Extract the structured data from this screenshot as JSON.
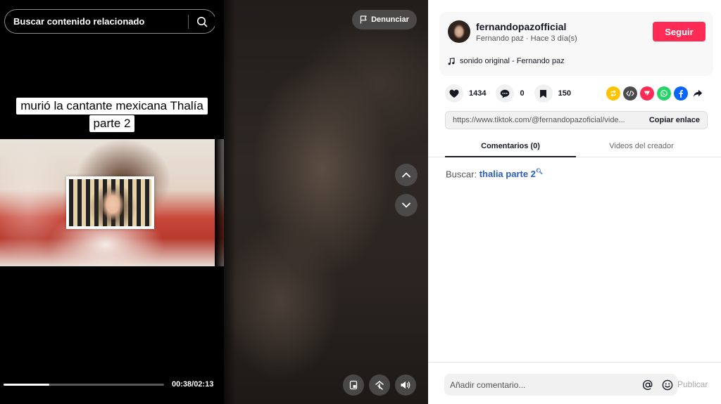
{
  "player": {
    "search_placeholder": "Buscar contenido relacionado",
    "caption_line1": "murió la cantante mexicana Thalía",
    "caption_line2": "parte 2",
    "time": "00:38/02:13",
    "progress": 0.285,
    "report_label": "Denunciar"
  },
  "author": {
    "username": "fernandopazofficial",
    "display_line": "Fernando paz · Hace 3 día(s)",
    "follow_label": "Seguir",
    "sound": "sonido original - Fernando paz"
  },
  "stats": {
    "likes": "1434",
    "comments": "0",
    "saves": "150"
  },
  "share": {
    "icons": [
      "repost-icon",
      "embed-icon",
      "send-icon",
      "whatsapp-icon",
      "facebook-icon",
      "share-arrow-icon"
    ],
    "colors": {
      "repost": "#ffc300",
      "embed": "#4b4b4b",
      "send": "#fe2c55",
      "whatsapp": "#25d366",
      "facebook": "#0866ff"
    }
  },
  "link": {
    "url": "https://www.tiktok.com/@fernandopazoficial/vide...",
    "copy_label": "Copiar enlace"
  },
  "tabs": {
    "comments": "Comentarios (0)",
    "creator_videos": "Videos del creador"
  },
  "related_search": {
    "prefix": "Buscar:",
    "term": "thalia parte 2"
  },
  "comment_input": {
    "placeholder": "Añadir comentario...",
    "publish_label": "Publicar"
  },
  "colors": {
    "accent": "#fe2c55",
    "link": "#2b5db9"
  }
}
